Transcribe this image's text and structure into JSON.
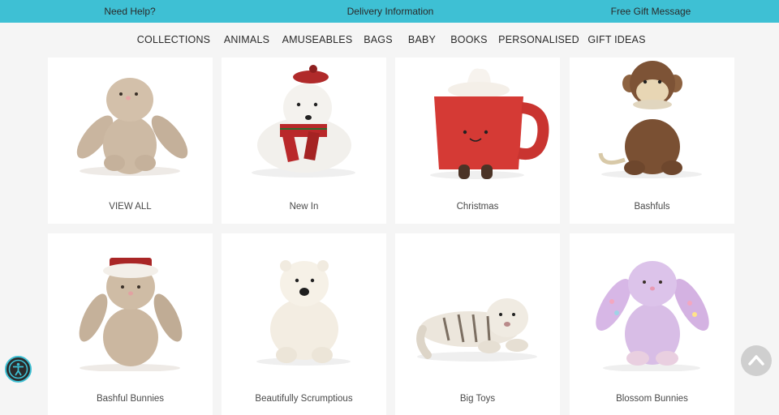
{
  "topbar": {
    "help": "Need Help?",
    "delivery": "Delivery Information",
    "gift": "Free Gift Message"
  },
  "nav": [
    "COLLECTIONS",
    "ANIMALS",
    "AMUSEABLES",
    "BAGS",
    "BABY",
    "BOOKS",
    "PERSONALISED",
    "GIFT IDEAS"
  ],
  "categories": [
    {
      "label": "VIEW ALL"
    },
    {
      "label": "New In"
    },
    {
      "label": "Christmas"
    },
    {
      "label": "Bashfuls"
    },
    {
      "label": "Bashful Bunnies"
    },
    {
      "label": "Beautifully Scrumptious"
    },
    {
      "label": "Big Toys"
    },
    {
      "label": "Blossom Bunnies"
    }
  ],
  "colors": {
    "topbar": "#3ec0d4",
    "page_bg": "#f5f5f5",
    "card_bg": "#ffffff"
  },
  "icons": {
    "accessibility": "accessibility-icon",
    "back_to_top": "chevron-up-icon"
  }
}
